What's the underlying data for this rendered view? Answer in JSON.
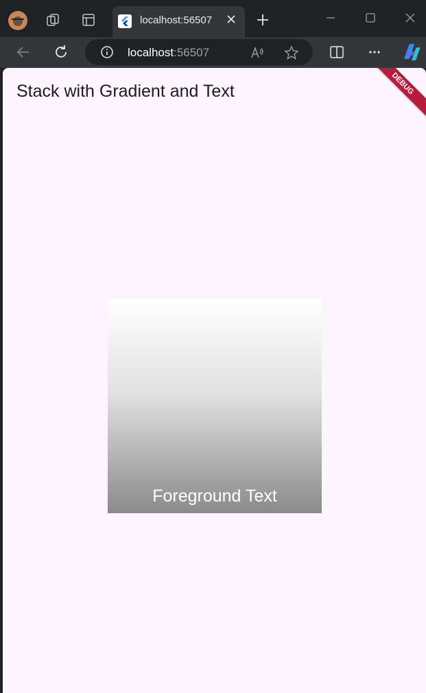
{
  "browser": {
    "tab": {
      "title": "localhost:56507"
    },
    "address": {
      "host": "localhost",
      "port": ":56507"
    }
  },
  "app": {
    "title": "Stack with Gradient and Text",
    "debug_banner": "DEBUG",
    "foreground_text": "Foreground Text"
  },
  "colors": {
    "page_background": "#fdf5fd",
    "banner": "#b71c3a",
    "gradient_top": "#ffffff",
    "gradient_bottom": "#8a8a8a"
  }
}
